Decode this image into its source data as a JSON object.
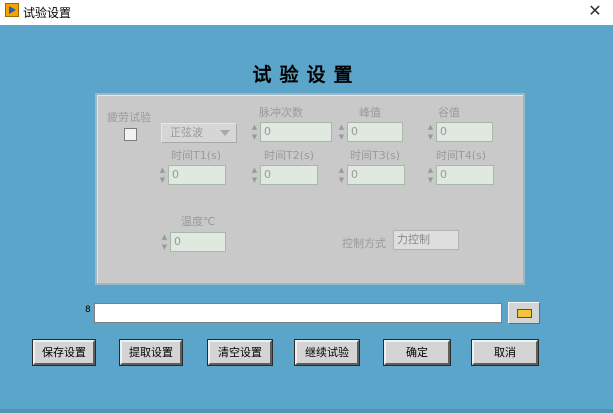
{
  "window": {
    "title": "试验设置",
    "close_glyph": "✕"
  },
  "heading": "试验设置",
  "settings": {
    "fatigue_label": "疲劳试验",
    "waveform_value": "正弦波",
    "pulse_count": {
      "label": "脉冲次数",
      "value": "0"
    },
    "peak": {
      "label": "峰值",
      "value": "0"
    },
    "valley": {
      "label": "谷值",
      "value": "0"
    },
    "t1": {
      "label": "时间T1(s)",
      "value": "0"
    },
    "t2": {
      "label": "时间T2(s)",
      "value": "0"
    },
    "t3": {
      "label": "时间T3(s)",
      "value": "0"
    },
    "t4": {
      "label": "时间T4(s)",
      "value": "0"
    },
    "temperature": {
      "label": "温度℃",
      "value": "0"
    },
    "control_mode": {
      "label": "控制方式",
      "value": "力控制"
    }
  },
  "path": {
    "icon": "8",
    "value": ""
  },
  "buttons": {
    "save": "保存设置",
    "load": "提取设置",
    "clear": "清空设置",
    "resume": "继续试验",
    "ok": "确定",
    "cancel": "取消"
  },
  "icons": {
    "app": "labview-run-icon",
    "close": "close-icon",
    "browse": "folder-icon"
  },
  "colors": {
    "panel": "#5aa5c9",
    "group": "#c9c9c9",
    "numeric_field": "#dfe9df"
  }
}
